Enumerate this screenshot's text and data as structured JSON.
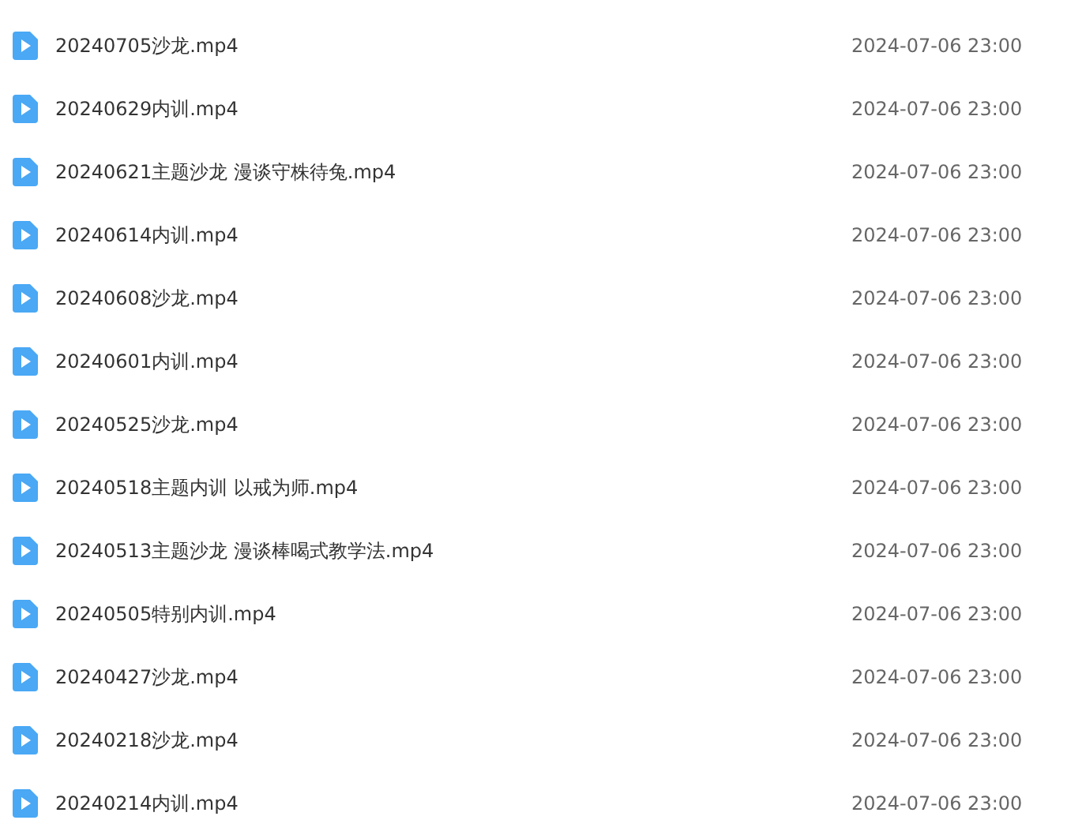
{
  "files": [
    {
      "name": "20240705沙龙.mp4",
      "modified": "2024-07-06 23:00"
    },
    {
      "name": "20240629内训.mp4",
      "modified": "2024-07-06 23:00"
    },
    {
      "name": "20240621主题沙龙 漫谈守株待兔.mp4",
      "modified": "2024-07-06 23:00"
    },
    {
      "name": "20240614内训.mp4",
      "modified": "2024-07-06 23:00"
    },
    {
      "name": "20240608沙龙.mp4",
      "modified": "2024-07-06 23:00"
    },
    {
      "name": "20240601内训.mp4",
      "modified": "2024-07-06 23:00"
    },
    {
      "name": "20240525沙龙.mp4",
      "modified": "2024-07-06 23:00"
    },
    {
      "name": "20240518主题内训 以戒为师.mp4",
      "modified": "2024-07-06 23:00"
    },
    {
      "name": "20240513主题沙龙 漫谈棒喝式教学法.mp4",
      "modified": "2024-07-06 23:00"
    },
    {
      "name": "20240505特别内训.mp4",
      "modified": "2024-07-06 23:00"
    },
    {
      "name": "20240427沙龙.mp4",
      "modified": "2024-07-06 23:00"
    },
    {
      "name": "20240218沙龙.mp4",
      "modified": "2024-07-06 23:00"
    },
    {
      "name": "20240214内训.mp4",
      "modified": "2024-07-06 23:00"
    }
  ]
}
